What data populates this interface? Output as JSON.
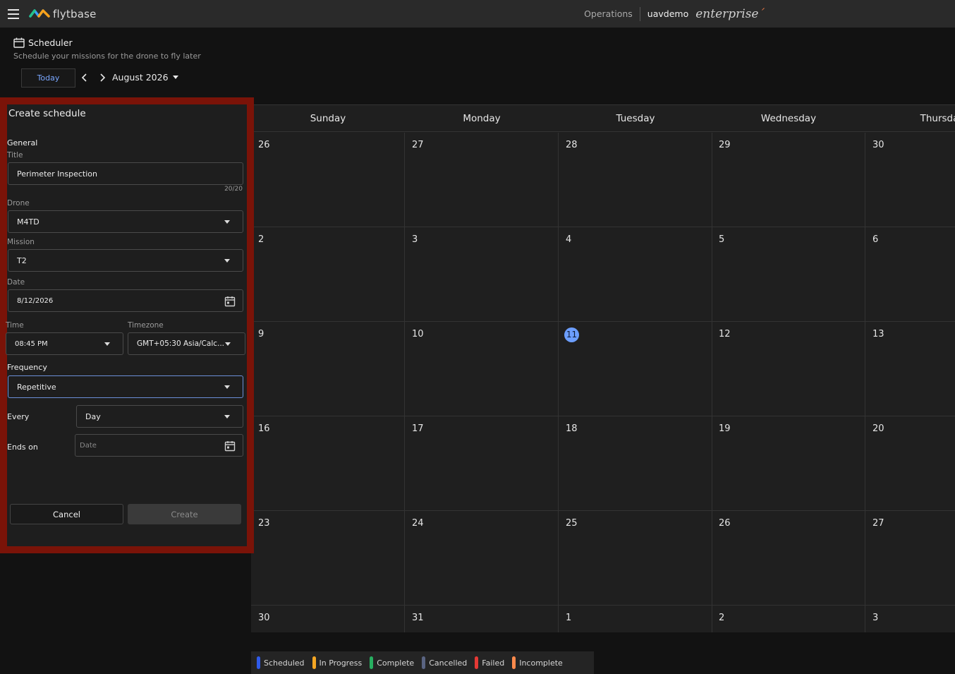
{
  "app": {
    "brand": "flytbase",
    "nav_operations": "Operations",
    "username": "uavdemo",
    "edition": "enterprise"
  },
  "scheduler": {
    "title": "Scheduler",
    "subtitle": "Schedule your missions for the drone to fly later",
    "today_label": "Today",
    "month_label": "August 2026"
  },
  "calendar": {
    "weekdays": [
      "Sunday",
      "Monday",
      "Tuesday",
      "Wednesday",
      "Thursday"
    ],
    "weeks": [
      [
        "26",
        "27",
        "28",
        "29",
        "30"
      ],
      [
        "2",
        "3",
        "4",
        "5",
        "6"
      ],
      [
        "9",
        "10",
        "11",
        "12",
        "13"
      ],
      [
        "16",
        "17",
        "18",
        "19",
        "20"
      ],
      [
        "23",
        "24",
        "25",
        "26",
        "27"
      ],
      [
        "30",
        "31",
        "1",
        "2",
        "3"
      ]
    ],
    "today": "11"
  },
  "legend": [
    {
      "label": "Scheduled",
      "color": "#2f5bea"
    },
    {
      "label": "In Progress",
      "color": "#f5a623"
    },
    {
      "label": "Complete",
      "color": "#27ae60"
    },
    {
      "label": "Cancelled",
      "color": "#5a6482"
    },
    {
      "label": "Failed",
      "color": "#e53935"
    },
    {
      "label": "Incomplete",
      "color": "#ff8a4c"
    }
  ],
  "form": {
    "heading": "Create schedule",
    "section_general": "General",
    "title_label": "Title",
    "title_value": "Perimeter Inspection",
    "title_counter": "20/20",
    "drone_label": "Drone",
    "drone_value": "M4TD",
    "mission_label": "Mission",
    "mission_value": "T2",
    "date_label": "Date",
    "date_value": "8/12/2026",
    "time_label": "Time",
    "time_value": "08:45 PM",
    "timezone_label": "Timezone",
    "timezone_value": "GMT+05:30 Asia/Calc...",
    "frequency_label": "Frequency",
    "frequency_value": "Repetitive",
    "every_label": "Every",
    "every_value": "Day",
    "ends_on_label": "Ends on",
    "ends_on_placeholder": "Date",
    "cancel_label": "Cancel",
    "create_label": "Create"
  }
}
